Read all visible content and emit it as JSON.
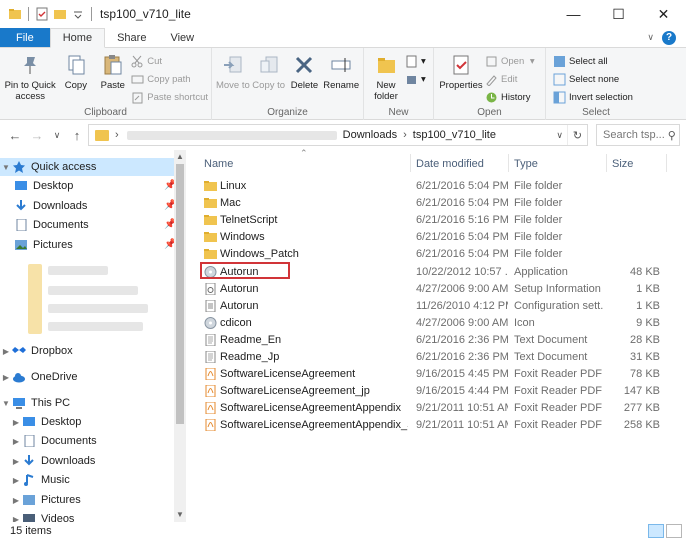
{
  "window": {
    "title": "tsp100_v710_lite"
  },
  "ribbon_tabs": [
    "File",
    "Home",
    "Share",
    "View"
  ],
  "ribbon": {
    "clipboard": {
      "label": "Clipboard",
      "pin": "Pin to Quick access",
      "copy": "Copy",
      "paste": "Paste",
      "cut": "Cut",
      "copy_path": "Copy path",
      "paste_shortcut": "Paste shortcut"
    },
    "organize": {
      "label": "Organize",
      "move_to": "Move to",
      "copy_to": "Copy to",
      "delete": "Delete",
      "rename": "Rename"
    },
    "new": {
      "label": "New",
      "new_folder": "New folder"
    },
    "open": {
      "label": "Open",
      "properties": "Properties",
      "open": "Open",
      "edit": "Edit",
      "history": "History"
    },
    "select": {
      "label": "Select",
      "select_all": "Select all",
      "select_none": "Select none",
      "invert": "Invert selection"
    }
  },
  "address": {
    "crumbs": [
      "Downloads",
      "tsp100_v710_lite"
    ],
    "search_placeholder": "Search tsp..."
  },
  "nav": {
    "quick_access": "Quick access",
    "quick_items": [
      "Desktop",
      "Downloads",
      "Documents",
      "Pictures"
    ],
    "dropbox": "Dropbox",
    "onedrive": "OneDrive",
    "this_pc": "This PC",
    "pc_items": [
      "Desktop",
      "Documents",
      "Downloads",
      "Music",
      "Pictures",
      "Videos"
    ]
  },
  "columns": {
    "name": "Name",
    "date": "Date modified",
    "type": "Type",
    "size": "Size"
  },
  "files": [
    {
      "name": "Linux",
      "date": "6/21/2016 5:04 PM",
      "type": "File folder",
      "size": "",
      "icon": "folder-icon"
    },
    {
      "name": "Mac",
      "date": "6/21/2016 5:04 PM",
      "type": "File folder",
      "size": "",
      "icon": "folder-icon"
    },
    {
      "name": "TelnetScript",
      "date": "6/21/2016 5:16 PM",
      "type": "File folder",
      "size": "",
      "icon": "folder-icon"
    },
    {
      "name": "Windows",
      "date": "6/21/2016 5:04 PM",
      "type": "File folder",
      "size": "",
      "icon": "folder-icon"
    },
    {
      "name": "Windows_Patch",
      "date": "6/21/2016 5:04 PM",
      "type": "File folder",
      "size": "",
      "icon": "folder-icon"
    },
    {
      "name": "Autorun",
      "date": "10/22/2012 10:57 ...",
      "type": "Application",
      "size": "48 KB",
      "icon": "disc-icon"
    },
    {
      "name": "Autorun",
      "date": "4/27/2006 9:00 AM",
      "type": "Setup Information",
      "size": "1 KB",
      "icon": "setup-icon"
    },
    {
      "name": "Autorun",
      "date": "11/26/2010 4:12 PM",
      "type": "Configuration sett...",
      "size": "1 KB",
      "icon": "config-icon"
    },
    {
      "name": "cdicon",
      "date": "4/27/2006 9:00 AM",
      "type": "Icon",
      "size": "9 KB",
      "icon": "disc-icon"
    },
    {
      "name": "Readme_En",
      "date": "6/21/2016 2:36 PM",
      "type": "Text Document",
      "size": "28 KB",
      "icon": "text-icon"
    },
    {
      "name": "Readme_Jp",
      "date": "6/21/2016 2:36 PM",
      "type": "Text Document",
      "size": "31 KB",
      "icon": "text-icon"
    },
    {
      "name": "SoftwareLicenseAgreement",
      "date": "9/16/2015 4:45 PM",
      "type": "Foxit Reader PDF ...",
      "size": "78 KB",
      "icon": "pdf-icon"
    },
    {
      "name": "SoftwareLicenseAgreement_jp",
      "date": "9/16/2015 4:44 PM",
      "type": "Foxit Reader PDF ...",
      "size": "147 KB",
      "icon": "pdf-icon"
    },
    {
      "name": "SoftwareLicenseAgreementAppendix",
      "date": "9/21/2011 10:51 AM",
      "type": "Foxit Reader PDF ...",
      "size": "277 KB",
      "icon": "pdf-icon"
    },
    {
      "name": "SoftwareLicenseAgreementAppendix_Set...",
      "date": "9/21/2011 10:51 AM",
      "type": "Foxit Reader PDF ...",
      "size": "258 KB",
      "icon": "pdf-icon"
    }
  ],
  "status": {
    "items": "15 items"
  },
  "colors": {
    "accent": "#1979ca",
    "folder": "#f0c44f",
    "highlight": "#d13438",
    "selection": "#cce8ff"
  }
}
